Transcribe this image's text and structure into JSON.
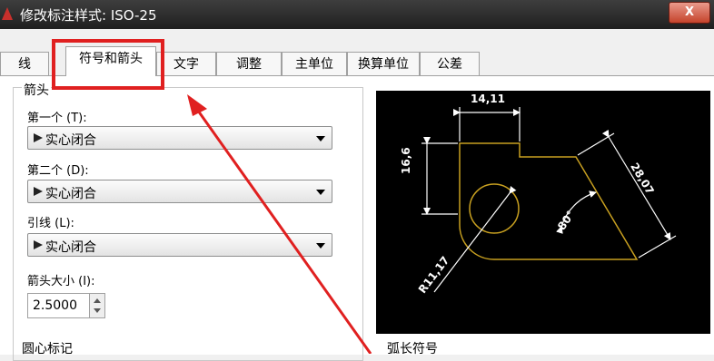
{
  "window": {
    "title": "修改标注样式: ISO-25",
    "close_label": "X"
  },
  "tabs": [
    {
      "label": "线"
    },
    {
      "label": "符号和箭头",
      "active": true
    },
    {
      "label": "文字"
    },
    {
      "label": "调整"
    },
    {
      "label": "主单位"
    },
    {
      "label": "换算单位"
    },
    {
      "label": "公差"
    }
  ],
  "arrowheads": {
    "group_title": "箭头",
    "first_label": "第一个 (T):",
    "first_value": "实心闭合",
    "second_label": "第二个 (D):",
    "second_value": "实心闭合",
    "leader_label": "引线 (L):",
    "leader_value": "实心闭合",
    "size_label": "箭头大小 (I):",
    "size_value": "2.5000"
  },
  "center_marks": {
    "title": "圆心标记"
  },
  "arc_length": {
    "title": "弧长符号"
  },
  "preview": {
    "dim_top": "14,11",
    "dim_left": "16,6",
    "dim_right": "28,07",
    "dim_angle": "80°",
    "dim_radius": "R11,17"
  },
  "colors": {
    "highlight": "#e02020",
    "preview_bg": "#000000",
    "preview_geometry": "#c8a020",
    "preview_dimensions": "#ffffff"
  }
}
